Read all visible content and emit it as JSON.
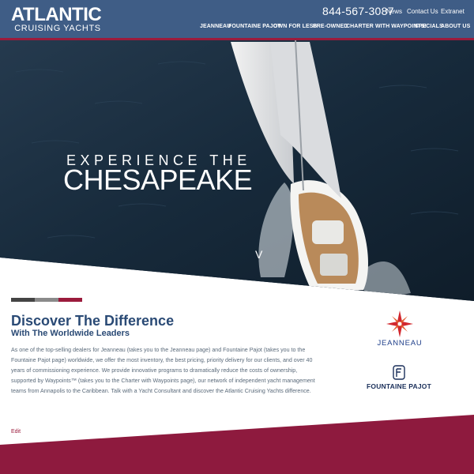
{
  "brand": {
    "name": "ATLANTIC",
    "tagline": "CRUISING YACHTS"
  },
  "header": {
    "phone": "844-567-3087",
    "utility_links": [
      "News",
      "Contact Us",
      "Extranet"
    ],
    "nav": [
      "JEANNEAU",
      "FOUNTAINE PAJOT",
      "OWN FOR LESS",
      "PRE-OWNED",
      "CHARTER WITH WAYPOINTS!",
      "SPECIALS",
      "ABOUT US"
    ]
  },
  "hero": {
    "line1": "EXPERIENCE THE",
    "line2": "CHESAPEAKE",
    "scroll_glyph": "V"
  },
  "content": {
    "title": "Discover The Difference",
    "subtitle": "With The Worldwide Leaders",
    "body": "As one of the top-selling dealers for Jeanneau (takes you to the Jeanneau page) and Fountaine Pajot (takes you to the Fountaine Pajot page) worldwide, we offer the most inventory, the best pricing, priority delivery for our clients, and over 40 years of commissioning experience. We provide innovative programs to dramatically reduce the costs of ownership, supported by Waypoints™ (takes you to the Charter with Waypoints page), our network of independent yacht management teams from Annapolis to the Caribbean. Talk with a Yacht Consultant and discover the Atlantic Cruising Yachts difference.",
    "edit_link": "Edit"
  },
  "brands": {
    "jeanneau": "JEANNEAU",
    "fountaine_pajot": "FOUNTAINE PAJOT"
  },
  "colors": {
    "header": "#3f5d86",
    "accent": "#9b1b3c",
    "heading": "#2a4a75",
    "tricolor": [
      "#444444",
      "#8a8a8a",
      "#9b1b3c"
    ]
  }
}
